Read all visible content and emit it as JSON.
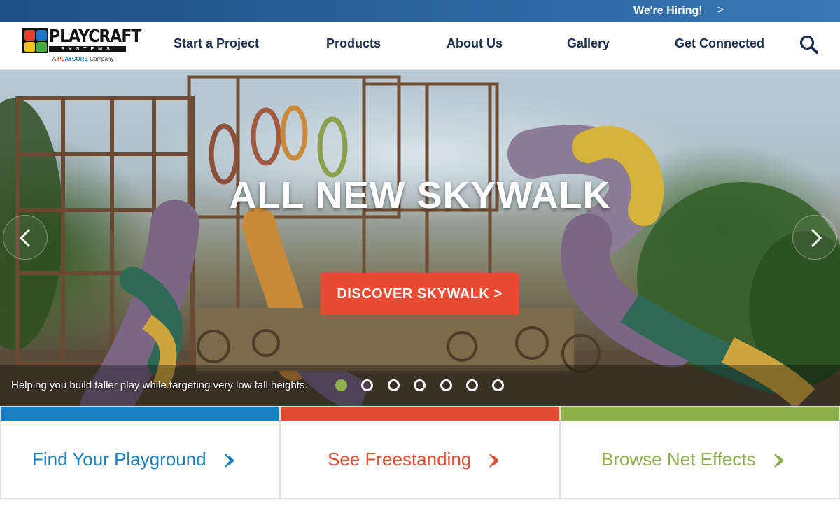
{
  "topbar": {
    "hiring_text": "We're Hiring!",
    "hiring_arrow": ">"
  },
  "logo": {
    "wordmark": "PLAYCRAFT",
    "systems": "SYSTEMS",
    "sub_prefix": "A",
    "sub_brand_a": "PL",
    "sub_brand_b": "AY",
    "sub_brand_c": "CORE",
    "sub_suffix": "Company"
  },
  "nav": {
    "items": [
      "Start a Project",
      "Products",
      "About Us",
      "Gallery",
      "Get Connected"
    ],
    "search_icon": "search-icon"
  },
  "hero": {
    "title": "ALL NEW SKYWALK",
    "cta_label": "DISCOVER SKYWALK",
    "cta_arrow": ">",
    "caption": "Helping you build taller play while targeting very low fall heights.",
    "slide_count": 7,
    "active_slide": 1,
    "prev_icon": "chevron-left-icon",
    "next_icon": "chevron-right-icon"
  },
  "cards": [
    {
      "label": "Find Your Playground",
      "color": "#1a7fbf"
    },
    {
      "label": "See Freestanding",
      "color": "#e24c32"
    },
    {
      "label": "Browse Net Effects",
      "color": "#8db04e"
    }
  ],
  "colors": {
    "topbar": "#2c64a0",
    "nav_text": "#1b2e4b",
    "cta": "#e84b31",
    "dot_active": "#8db04e"
  }
}
